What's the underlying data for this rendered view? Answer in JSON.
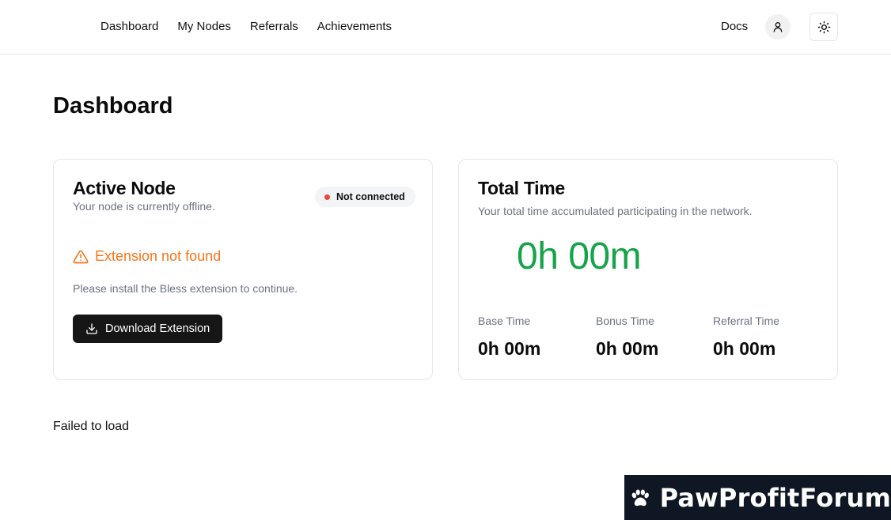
{
  "nav": {
    "items": [
      {
        "label": "Dashboard"
      },
      {
        "label": "My Nodes"
      },
      {
        "label": "Referrals"
      },
      {
        "label": "Achievements"
      }
    ],
    "docs_label": "Docs"
  },
  "page": {
    "title": "Dashboard",
    "footer_status": "Failed to load"
  },
  "active_node": {
    "title": "Active Node",
    "subtitle": "Your node is currently offline.",
    "status_label": "Not connected",
    "warning": "Extension not found",
    "install_text": "Please install the Bless extension to continue.",
    "download_label": "Download Extension"
  },
  "total_time": {
    "title": "Total Time",
    "subtitle": "Your total time accumulated participating in the network.",
    "total": "0h 00m",
    "stats": [
      {
        "label": "Base Time",
        "value": "0h 00m"
      },
      {
        "label": "Bonus Time",
        "value": "0h 00m"
      },
      {
        "label": "Referral Time",
        "value": "0h 00m"
      }
    ]
  },
  "watermark": {
    "text": "PawProfitForum"
  },
  "icons": {
    "user": "user-icon",
    "theme": "sun-icon",
    "warning": "warning-triangle-icon",
    "download": "download-icon",
    "paw": "paw-icon"
  },
  "colors": {
    "status_offline": "#ef4444",
    "warning": "#f97316",
    "total_time": "#16a34a",
    "primary_button": "#161616"
  }
}
